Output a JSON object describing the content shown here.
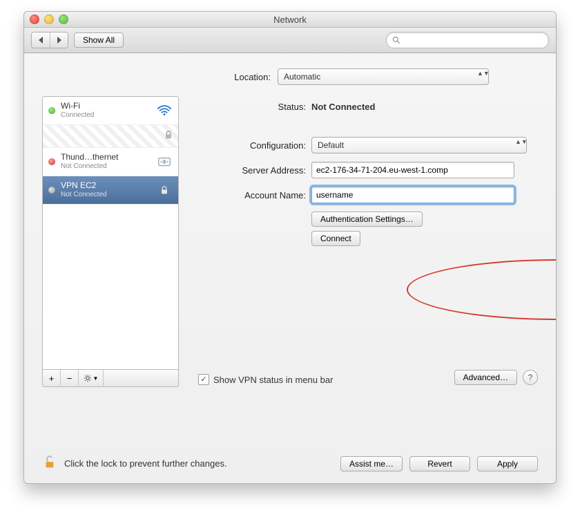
{
  "window": {
    "title": "Network"
  },
  "toolbar": {
    "show_all": "Show All",
    "search_placeholder": ""
  },
  "location": {
    "label": "Location:",
    "value": "Automatic"
  },
  "services": [
    {
      "name": "Wi-Fi",
      "status": "Connected",
      "dot": "green",
      "icon": "wifi"
    },
    {
      "name": "Thund…thernet",
      "status": "Not Connected",
      "dot": "red",
      "icon": "ethernet"
    },
    {
      "name": "VPN EC2",
      "status": "Not Connected",
      "dot": "gray",
      "icon": "lock",
      "selected": true
    }
  ],
  "footer": {
    "add": "+",
    "remove": "−",
    "gear": "⚙▾"
  },
  "detail": {
    "status_label": "Status:",
    "status_value": "Not Connected",
    "config_label": "Configuration:",
    "config_value": "Default",
    "server_label": "Server Address:",
    "server_value": "ec2-176-34-71-204.eu-west-1.comp",
    "account_label": "Account Name:",
    "account_value": "username",
    "auth_button": "Authentication Settings…",
    "connect_button": "Connect",
    "vpn_status_checkbox": "Show VPN status in menu bar",
    "vpn_status_checked": true,
    "advanced_button": "Advanced…"
  },
  "bottom": {
    "lock_text": "Click the lock to prevent further changes.",
    "assist": "Assist me…",
    "revert": "Revert",
    "apply": "Apply"
  }
}
